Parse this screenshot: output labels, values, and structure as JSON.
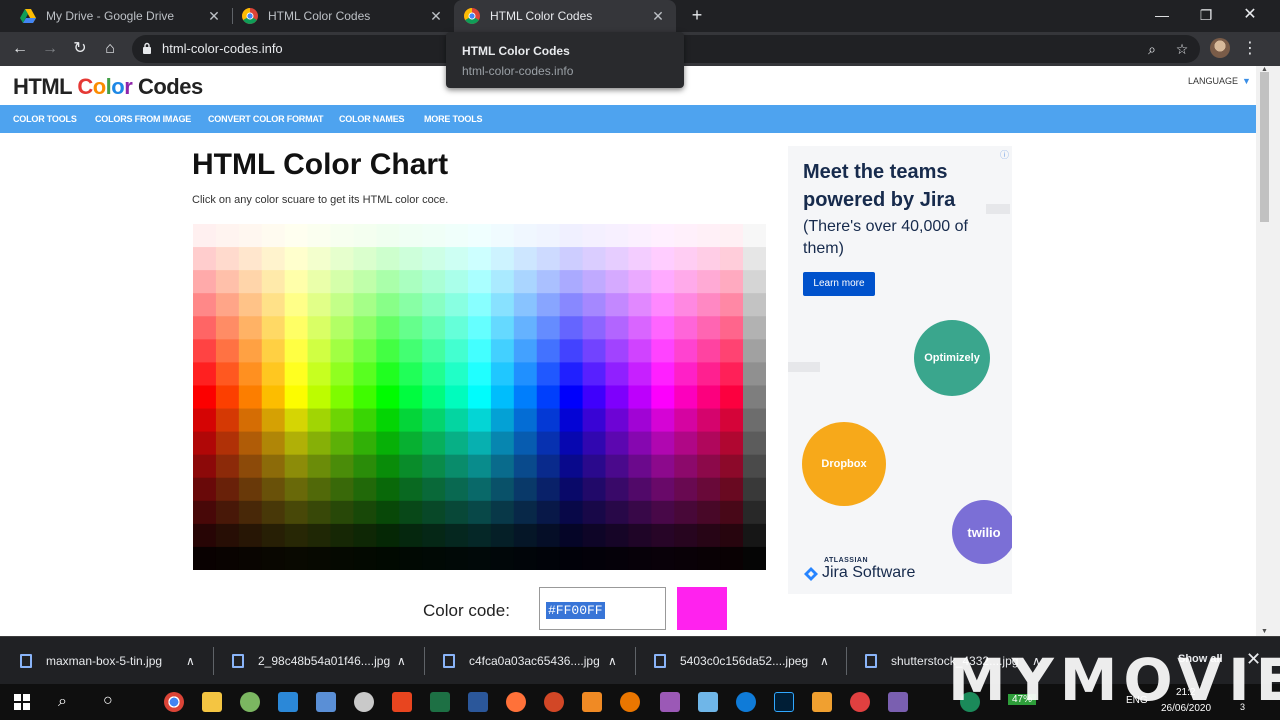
{
  "tabs": [
    {
      "title": "My Drive - Google Drive"
    },
    {
      "title": "HTML Color Codes"
    },
    {
      "title": "HTML Color Codes",
      "active": true
    }
  ],
  "address": {
    "url": "html-color-codes.info"
  },
  "tooltip": {
    "title": "HTML Color Codes",
    "url": "html-color-codes.info"
  },
  "site": {
    "logo_part1": "HTML",
    "logo_part2": [
      "C",
      "o",
      "l",
      "o",
      "r"
    ],
    "logo_part3": "Codes",
    "language": "LANGUAGE",
    "nav": [
      "COLOR TOOLS",
      "COLORS FROM IMAGE",
      "CONVERT COLOR FORMAT",
      "COLOR NAMES",
      "MORE TOOLS"
    ]
  },
  "main": {
    "title": "HTML Color Chart",
    "subtitle": "Click on any color scuare to get its HTML color coce.",
    "color_code_label": "Color code:",
    "color_code_value": "#FF00FF",
    "swatch_color": "#ff22ee"
  },
  "ad": {
    "headline": "Meet the teams powered by Jira",
    "body": "(There's over 40,000 of them)",
    "button": "Learn more",
    "bubbles": [
      "Optimizely",
      "Dropbox",
      "twilio"
    ],
    "brand_small": "ATLASSIAN",
    "brand": "Jira Software"
  },
  "downloads": [
    {
      "name": "maxman-box-5-tin.jpg"
    },
    {
      "name": "2_98c48b54a01f46....jpg"
    },
    {
      "name": "c4fca0a03ac65436....jpg"
    },
    {
      "name": "5403c0c156da52....jpeg"
    },
    {
      "name": "shutterstock_4332....jpg"
    }
  ],
  "download_bar": {
    "show_all": "Show all"
  },
  "taskbar": {
    "battery": "47%",
    "lang": "ENG",
    "time": "21:2",
    "date": "26/06/2020",
    "notifications": "3"
  },
  "watermark": "MYMOVIE",
  "colors": {
    "accent_nav": "#4ea3ef",
    "chrome_dark": "#202124",
    "jira_blue": "#0052cc"
  }
}
